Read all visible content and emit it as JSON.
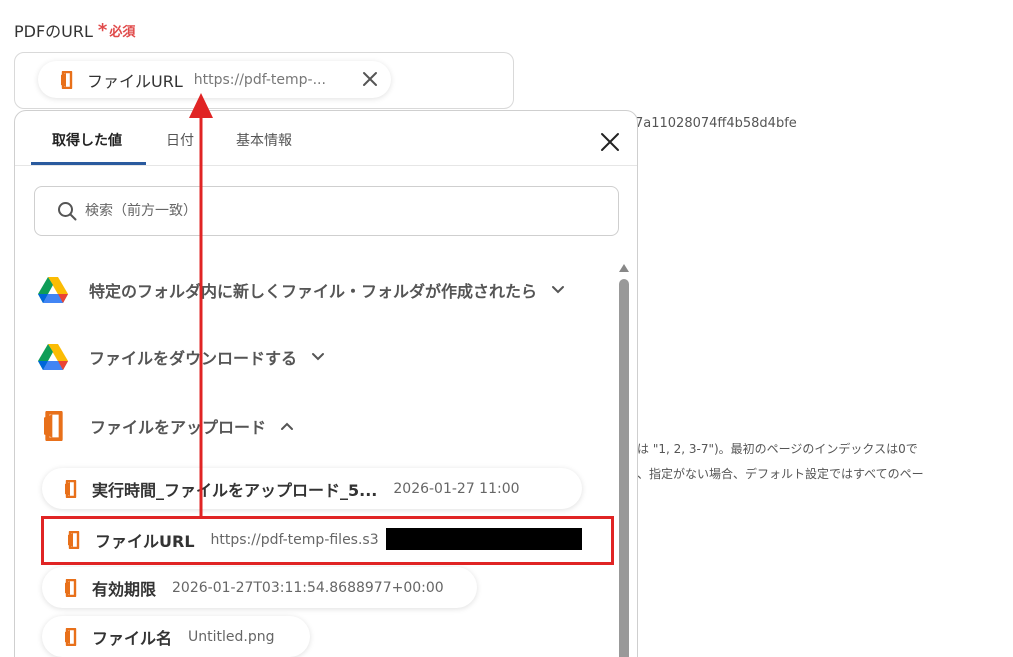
{
  "field": {
    "label": "PDFのURL",
    "required_star": "*",
    "required_text": "必須",
    "selected": {
      "name": "ファイルURL",
      "value": "https://pdf-temp-..."
    }
  },
  "background": {
    "hash_text": "7a11028074ff4b58d4bfe",
    "line1": "は \"1, 2, 3-7\")。最初のページのインデックスは0で",
    "line2": "、指定がない場合、デフォルト設定ではすべてのペー"
  },
  "panel": {
    "tabs": [
      {
        "label": "取得した値",
        "active": true
      },
      {
        "label": "日付",
        "active": false
      },
      {
        "label": "基本情報",
        "active": false
      }
    ],
    "search": {
      "placeholder": "検索（前方一致）",
      "value": ""
    },
    "sections": [
      {
        "title": "特定のフォルダ内に新しくファイル・フォルダが作成されたら",
        "icon": "google-drive-icon",
        "expanded": false
      },
      {
        "title": "ファイルをダウンロードする",
        "icon": "google-drive-icon",
        "expanded": false
      },
      {
        "title": "ファイルをアップロード",
        "icon": "office-icon",
        "expanded": true
      }
    ],
    "items": [
      {
        "name": "実行時間_ファイルをアップロード_5...",
        "value": "2026-01-27 11:00"
      },
      {
        "name": "ファイルURL",
        "value": "https://pdf-temp-files.s3"
      },
      {
        "name": "有効期限",
        "value": "2026-01-27T03:11:54.8688977+00:00"
      },
      {
        "name": "ファイル名",
        "value": "Untitled.png"
      }
    ]
  },
  "colors": {
    "required": "#e04a4a",
    "highlight": "#e02424",
    "tab_underline": "#2a5a9e",
    "office_orange": "#e8701a"
  }
}
